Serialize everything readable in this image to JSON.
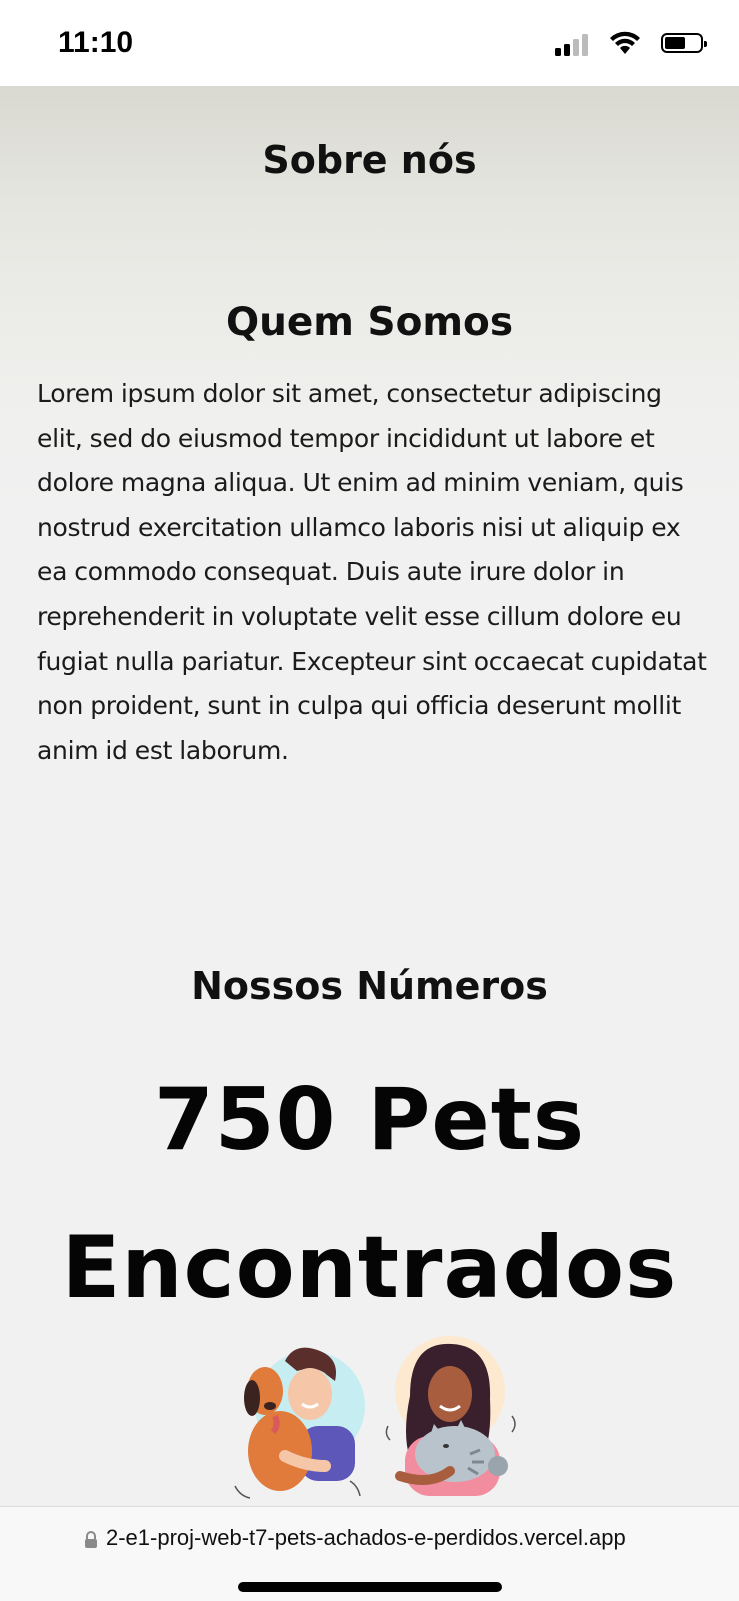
{
  "status_bar": {
    "time": "11:10",
    "signal_icon": "cellular-signal-icon",
    "wifi_icon": "wifi-icon",
    "battery_icon": "battery-icon"
  },
  "page": {
    "title": "Sobre nós",
    "about": {
      "heading": "Quem Somos",
      "text": "Lorem ipsum dolor sit amet, consectetur adipiscing elit, sed do eiusmod tempor incididunt ut labore et dolore magna aliqua. Ut enim ad minim veniam, quis nostrud exercitation ullamco laboris nisi ut aliquip ex ea commodo consequat. Duis aute irure dolor in reprehenderit in voluptate velit esse cillum dolore eu fugiat nulla pariatur. Excepteur sint occaecat cupidatat non proident, sunt in culpa qui officia deserunt mollit anim id est laborum."
    },
    "numbers": {
      "heading": "Nossos Números",
      "stat": "750 Pets Encontrados"
    },
    "illustrations": [
      "man-hugging-dog-illustration",
      "woman-holding-cat-illustration"
    ]
  },
  "browser": {
    "url": "2-e1-proj-web-t7-pets-achados-e-perdidos.vercel.app",
    "lock_icon": "lock-icon"
  },
  "colors": {
    "text": "#111111",
    "background": "#f1f1f1",
    "header_gradient_top": "#d9d9d1"
  }
}
